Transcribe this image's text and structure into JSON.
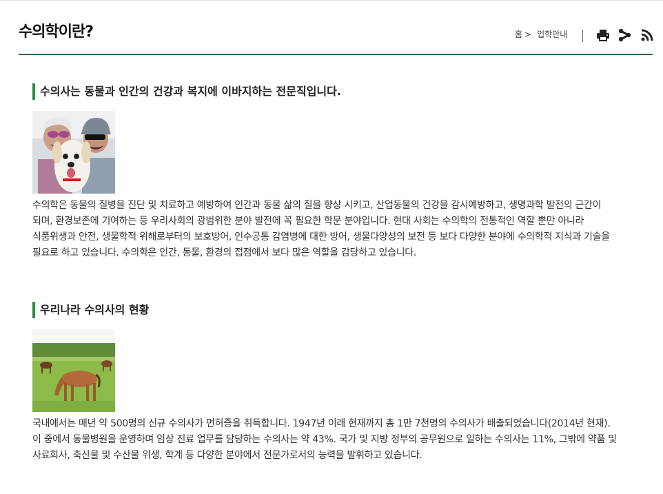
{
  "header": {
    "title": "수의학이란?",
    "breadcrumb": {
      "home": "홈",
      "separator": ">",
      "current": "입학안내"
    },
    "tools": [
      {
        "icon": "print-icon",
        "label": "인쇄"
      },
      {
        "icon": "share-icon",
        "label": "공유"
      },
      {
        "icon": "rss-icon",
        "label": "RSS"
      }
    ]
  },
  "colors": {
    "accent_green": "#2e8b4a",
    "header_line": "#2e6b45"
  },
  "sections": [
    {
      "title": "수의사는 동물과 인간의 건강과 복지에 이바지하는 전문직입니다.",
      "image": "couple-with-dog-photo",
      "body": "수의학은 동물의 질병을 진단 및 치료하고 예방하여 인간과 동물 삶의 질을 향상 시키고, 산업동물의 건강을 감시예방하고, 생명과학 발전의 근간이 되며, 환경보존에 기여하는 등 우리사회의 광범위한 분야 발전에 꼭 필요한 학문 분야입니다. 현대 사회는 수의학의 전통적인 역할 뿐만 아니라 식품위생과 안전, 생물학적 위해로부터의 보호방어, 인수공통 감염병에 대한 방어, 생물다양성의 보전 등 보다 다양한 분야에 수의학적 지식과 기술을 필요로 하고 있습니다. 수의학은 인간, 동물, 환경의 접점에서 보다 많은 역할을 감당하고 있습니다."
    },
    {
      "title": "우리나라 수의사의 현황",
      "image": "horses-in-pasture-photo",
      "body": "국내에서는 매년 약 500명의 신규 수의사가 면허증을 취득합니다. 1947년 이래 현재까지 총 1만 7천명의 수의사가 배출되었습니다(2014년 현재). 이 중에서 동물병원을 운영하며 임상 진료 업무를 담당하는 수의사는 약 43%. 국가 및 지방 정부의 공무원으로 일하는 수의사는 11%, 그밖에 약품 및 사료회사, 축산물 및 수산물 위생, 학계 등 다양한 분야에서 전문가로서의 능력을 발휘하고 있습니다."
    }
  ]
}
